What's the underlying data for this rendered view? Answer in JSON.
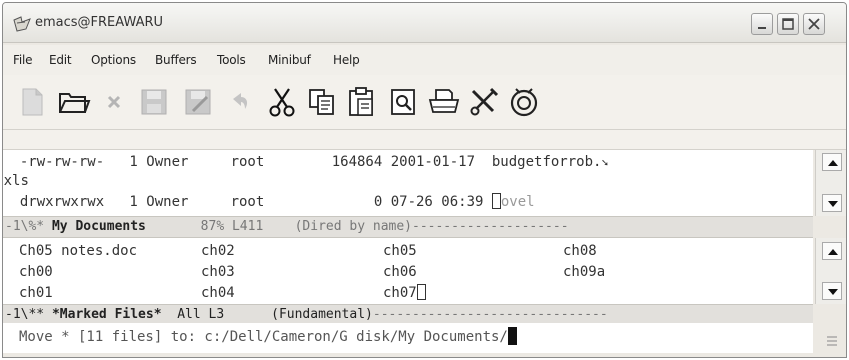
{
  "window": {
    "title": "emacs@FREAWARU"
  },
  "menubar": {
    "items": [
      "File",
      "Edit",
      "Options",
      "Buffers",
      "Tools",
      "Minibuf",
      "Help"
    ]
  },
  "toolbar": {
    "buttons": [
      "new-file-icon",
      "open-folder-icon",
      "close-icon",
      "save-icon",
      "save-as-icon",
      "undo-icon",
      "cut-icon",
      "copy-icon",
      "paste-icon",
      "search-icon",
      "print-icon",
      "customize-icon",
      "help-icon"
    ]
  },
  "dired": {
    "lines": [
      "  -rw-rw-rw-   1 Owner     root        164864 2001-01-17  budgetforrob.",
      "xls",
      "  drwxrwxrwx   1 Owner     root             0 07-26 06:39 "
    ],
    "wrap_left_glyph": "¢",
    "wrap_right_glyph": "➘",
    "cursor_text": "n",
    "after_cursor": "ovel"
  },
  "modeline1": {
    "flags": "-1\\%* ",
    "buffer": "My Documents",
    "middle": "       87% L411    (Dired by name)",
    "fill": "--------------------"
  },
  "files": {
    "rows": [
      [
        "Ch05 notes.doc",
        "ch02",
        "ch05",
        "ch08"
      ],
      [
        "ch00",
        "ch03",
        "ch06",
        "ch09a"
      ],
      [
        "ch01",
        "ch04",
        "ch07",
        ""
      ]
    ]
  },
  "modeline2": {
    "flags": "-1\\** ",
    "buffer": "*Marked Files*",
    "middle": "  All L3      (Fundamental)",
    "fill": "------------------------------"
  },
  "minibuffer": {
    "prompt": "Move * [11 files] to: c:/Dell/Cameron/G disk/My Documents/"
  },
  "colors": {
    "modeline_bg": "#e2e0dc",
    "window_bg": "#ece9e3",
    "text": "#333333"
  }
}
